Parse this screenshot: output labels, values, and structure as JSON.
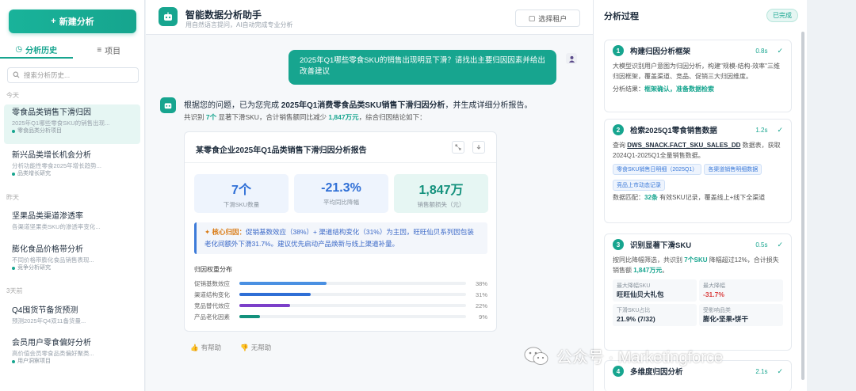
{
  "sidebar": {
    "new_label": "新建分析",
    "tabs": [
      {
        "label": "分析历史"
      },
      {
        "label": "项目"
      }
    ],
    "search_placeholder": "搜索分析历史...",
    "groups": [
      "今天",
      "昨天",
      "3天前"
    ],
    "items": [
      {
        "title": "零食品类销售下滑归因",
        "sub": "2025年Q1哪些零食SKU的销售出现...",
        "tag": "零食品类分析项目"
      },
      {
        "title": "新兴品类增长机会分析",
        "sub": "分析功能性零食2025年增长趋势...",
        "tag": "品类增长研究"
      },
      {
        "title": "坚果品类渠道渗透率",
        "sub": "各渠道坚果类SKU的渗透率变化..."
      },
      {
        "title": "膨化食品价格带分析",
        "sub": "不同价格带膨化食品销售表现...",
        "tag": "竞争分析研究"
      },
      {
        "title": "Q4囤货节备货预测",
        "sub": "预测2025年Q4双11备货量..."
      },
      {
        "title": "会员用户零食偏好分析",
        "sub": "高价值会员零食品类偏好聚类...",
        "tag": "用户洞察项目"
      }
    ]
  },
  "header": {
    "title": "智能数据分析助手",
    "subtitle": "用自然语言提问，AI自动完成专业分析",
    "tenant_label": "选择租户"
  },
  "chat": {
    "user_message": "2025年Q1哪些零食SKU的销售出现明显下滑？请找出主要归因因素并给出改善建议",
    "bot_pre": "根据您的问题，已为您完成 ",
    "bot_bold": "2025年Q1消费零食品类SKU销售下滑归因分析",
    "bot_post": "，并生成详细分析报告。",
    "summary_a": "共识别 ",
    "summary_sku": "7个",
    "summary_b": " 显著下滑SKU，合计销售额同比减少 ",
    "summary_amount": "1,847万元",
    "summary_c": "，综合归因结论如下："
  },
  "report": {
    "title": "某零食企业2025年Q1品类销售下滑归因分析报告",
    "stats": [
      {
        "value": "7个",
        "label": "下滑SKU数量",
        "color": "#2f6fd6",
        "bg": "#eef4fd"
      },
      {
        "value": "-21.3%",
        "label": "平均同比降幅",
        "color": "#2f6fd6",
        "bg": "#eef4fd"
      },
      {
        "value": "1,847万",
        "label": "销售额损失（元）",
        "color": "#13917c",
        "bg": "#e6f6f3"
      }
    ],
    "insight_label": "核心归因：",
    "insight_text": "促销基数效应（38%）+ 渠道结构变化（31%）为主因，旺旺仙贝系列因包装老化间额外下滑31.7%。建议优先启动产品焕新与线上渠道补量。",
    "dist_title": "归因权重分布",
    "bars": [
      {
        "label": "促销基数效应",
        "value": 38,
        "pct": "38%",
        "color": "#4a90e2"
      },
      {
        "label": "渠道结构变化",
        "value": 31,
        "pct": "31%",
        "color": "#2f6fd6"
      },
      {
        "label": "竞品替代效应",
        "value": 22,
        "pct": "22%",
        "color": "#7b3fc9"
      },
      {
        "label": "产品老化因素",
        "value": 9,
        "pct": "9%",
        "color": "#13917c"
      }
    ]
  },
  "feedback": {
    "helpful": "有帮助",
    "unhelpful": "无帮助"
  },
  "panel": {
    "title": "分析过程",
    "status": "已完成",
    "steps": [
      {
        "num": "1",
        "title": "构建归因分析框架",
        "time": "0.8s",
        "body": "大模型识别用户意图为归因分析，构建\"规模-结构-效率\"三维归因框架，覆盖渠道、竞品、促销三大归因维度。",
        "result_label": "分析结果：",
        "result": "框架确认，准备数据检索"
      },
      {
        "num": "2",
        "title": "检索2025Q1零食销售数据",
        "time": "1.2s",
        "body_a": "查询 ",
        "table": "DWS_SNACK.FACT_SKU_SALES_DD",
        "body_b": " 数据表，获取2024Q1-2025Q1全量销售数据。",
        "chips": [
          "零食SKU销售日明细（2025Q1）",
          "各渠道销售明细数据",
          "竞品上市动态记录"
        ],
        "match_a": "数据匹配：",
        "match_n": "32条",
        "match_b": " 有效SKU记录，覆盖线上+线下全渠道"
      },
      {
        "num": "3",
        "title": "识别显著下滑SKU",
        "time": "0.5s",
        "body_a": "按同比降幅筛选，共识别 ",
        "sku": "7个SKU",
        "body_b": " 降幅超过12%，合计损失销售额 ",
        "amount": "1,847万元",
        "body_c": "。",
        "kv": [
          {
            "k": "最大降幅SKU",
            "v": "旺旺仙贝大礼包"
          },
          {
            "k": "最大降幅",
            "v": "-31.7%"
          },
          {
            "k": "下滑SKU占比",
            "v": "21.9% (7/32)"
          },
          {
            "k": "受影响品类",
            "v": "膨化•坚果•饼干"
          }
        ]
      },
      {
        "num": "4",
        "title": "多维度归因分析",
        "time": "2.1s"
      }
    ]
  },
  "watermark": {
    "text": "公众号 · Marketingforce"
  }
}
